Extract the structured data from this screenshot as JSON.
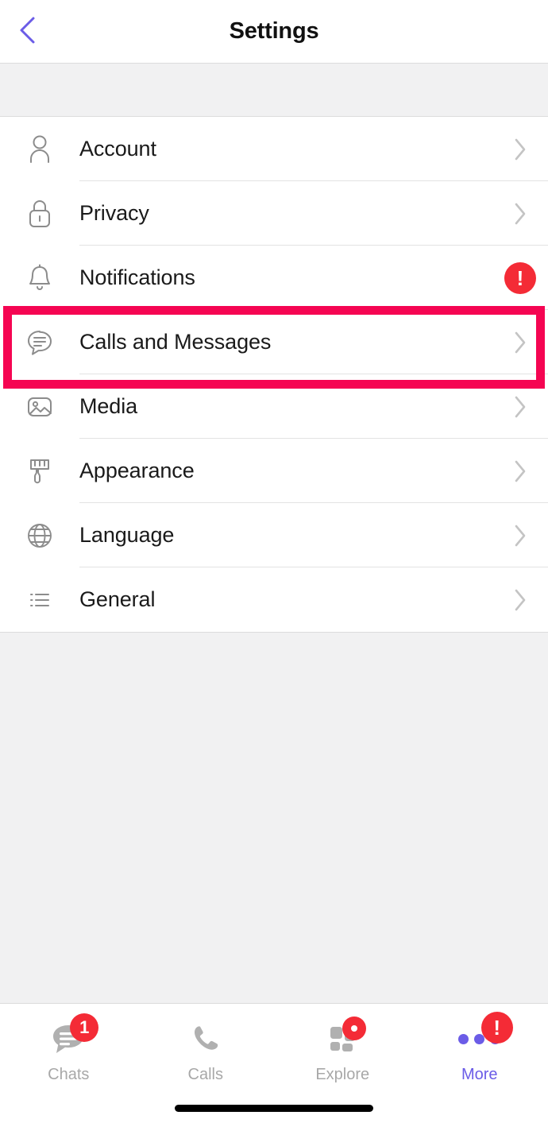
{
  "header": {
    "title": "Settings",
    "back_icon": "chevron-left-icon",
    "back_color": "#6b5ce7"
  },
  "colors": {
    "accent_purple": "#6b5ce7",
    "badge_red": "#f42b36",
    "highlight_pink": "#f50552",
    "separator": "#e3e3e3",
    "background_gray": "#f1f1f2",
    "label_text": "#1a1a1a",
    "icon_gray": "#8c8c8c",
    "chevron_gray": "#c4c4c4"
  },
  "settings": {
    "rows": [
      {
        "label": "Account",
        "icon": "person-icon",
        "accessory": "chevron",
        "badge": "",
        "highlighted": false
      },
      {
        "label": "Privacy",
        "icon": "lock-icon",
        "accessory": "chevron",
        "badge": "",
        "highlighted": false
      },
      {
        "label": "Notifications",
        "icon": "bell-icon",
        "accessory": "badge",
        "badge": "!",
        "highlighted": false
      },
      {
        "label": "Calls and Messages",
        "icon": "chat-bubble-icon",
        "accessory": "chevron",
        "badge": "",
        "highlighted": true
      },
      {
        "label": "Media",
        "icon": "image-icon",
        "accessory": "chevron",
        "badge": "",
        "highlighted": false
      },
      {
        "label": "Appearance",
        "icon": "paintbrush-icon",
        "accessory": "chevron",
        "badge": "",
        "highlighted": false
      },
      {
        "label": "Language",
        "icon": "globe-icon",
        "accessory": "chevron",
        "badge": "",
        "highlighted": false
      },
      {
        "label": "General",
        "icon": "list-icon",
        "accessory": "chevron",
        "badge": "",
        "highlighted": false
      }
    ]
  },
  "tabbar": {
    "tabs": [
      {
        "label": "Chats",
        "icon": "chat-bubble-filled-icon",
        "badge": "1",
        "badge_type": "count",
        "active": false
      },
      {
        "label": "Calls",
        "icon": "phone-icon",
        "badge": "",
        "badge_type": "none",
        "active": false
      },
      {
        "label": "Explore",
        "icon": "grid-squares-icon",
        "badge": "",
        "badge_type": "dot",
        "active": false
      },
      {
        "label": "More",
        "icon": "three-dots-icon",
        "badge": "!",
        "badge_type": "bang",
        "active": true
      }
    ]
  }
}
